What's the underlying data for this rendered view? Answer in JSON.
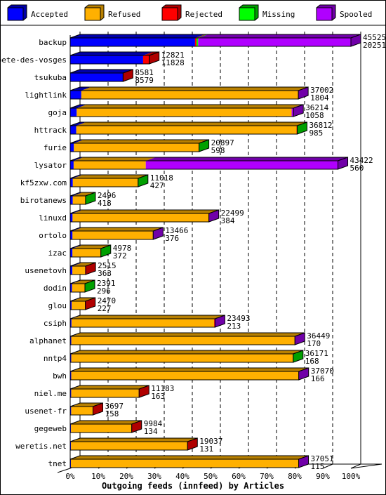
{
  "chart_data": {
    "type": "bar",
    "orientation": "horizontal",
    "stacked": true,
    "three_d": true,
    "title": "",
    "xlabel": "Outgoing feeds (innfeed) by Articles",
    "ylabel": "",
    "xlim": [
      0,
      100
    ],
    "x_unit": "%",
    "x_ticks": [
      "0%",
      "10%",
      "20%",
      "30%",
      "40%",
      "50%",
      "60%",
      "70%",
      "80%",
      "90%",
      "100%"
    ],
    "grid": true,
    "legend_position": "top",
    "categories": [
      "backup",
      "bete-des-vosges",
      "tsukuba",
      "lightlink",
      "goja",
      "httrack",
      "furie",
      "lysator",
      "kf5zxw.com",
      "birotanews",
      "linuxd",
      "ortolo",
      "izac",
      "usenetovh",
      "dodin",
      "glou",
      "csiph",
      "alphanet",
      "nntp4",
      "bwh",
      "niel.me",
      "usenet-fr",
      "gegeweb",
      "weretis.net",
      "tnet"
    ],
    "series": [
      {
        "name": "Accepted",
        "color": "#0000ff",
        "side_color": "#0000a8",
        "values": [
          20251,
          11828,
          8579,
          1804,
          1058,
          985,
          598,
          560,
          427,
          418,
          384,
          376,
          372,
          363,
          296,
          227,
          213,
          170,
          168,
          166,
          163,
          158,
          134,
          131,
          115
        ]
      },
      {
        "name": "Refused",
        "color": "#ffb000",
        "side_color": "#b88000",
        "values": [
          0,
          0,
          0,
          35148,
          34856,
          35727,
          20249,
          11697,
          10541,
          2028,
          22065,
          13040,
          4556,
          2052,
          2045,
          2193,
          23130,
          36229,
          35953,
          36854,
          10970,
          3489,
          9800,
          18856,
          36886
        ]
      },
      {
        "name": "Rejected",
        "color": "#ff0000",
        "side_color": "#b00000",
        "values": [
          250,
          993,
          2,
          0,
          0,
          50,
          0,
          0,
          0,
          0,
          0,
          0,
          0,
          100,
          0,
          50,
          100,
          0,
          0,
          0,
          50,
          50,
          50,
          50,
          0
        ]
      },
      {
        "name": "Missing",
        "color": "#00ff00",
        "side_color": "#00a000",
        "values": [
          250,
          0,
          0,
          0,
          0,
          50,
          50,
          0,
          50,
          50,
          0,
          0,
          50,
          0,
          50,
          0,
          0,
          0,
          50,
          0,
          0,
          0,
          0,
          0,
          0
        ]
      },
      {
        "name": "Spooled",
        "color": "#b000ff",
        "side_color": "#7000a8",
        "values": [
          24774,
          0,
          0,
          50,
          300,
          0,
          0,
          31165,
          0,
          0,
          50,
          50,
          0,
          0,
          0,
          0,
          50,
          50,
          0,
          50,
          0,
          0,
          0,
          0,
          50
        ]
      }
    ],
    "labels_total": [
      "45525",
      "12821",
      "8581",
      "37002",
      "36214",
      "36812",
      "20897",
      "43422",
      "11018",
      "2496",
      "22499",
      "13466",
      "4978",
      "2515",
      "2391",
      "2470",
      "23493",
      "36449",
      "36171",
      "37070",
      "11183",
      "3697",
      "9984",
      "19037",
      "37051"
    ],
    "labels_accepted": [
      "20251",
      "11828",
      "8579",
      "1804",
      "1058",
      "985",
      "598",
      "560",
      "427",
      "418",
      "384",
      "376",
      "372",
      "363",
      "296",
      "227",
      "213",
      "170",
      "168",
      "166",
      "163",
      "158",
      "134",
      "131",
      "115"
    ]
  }
}
